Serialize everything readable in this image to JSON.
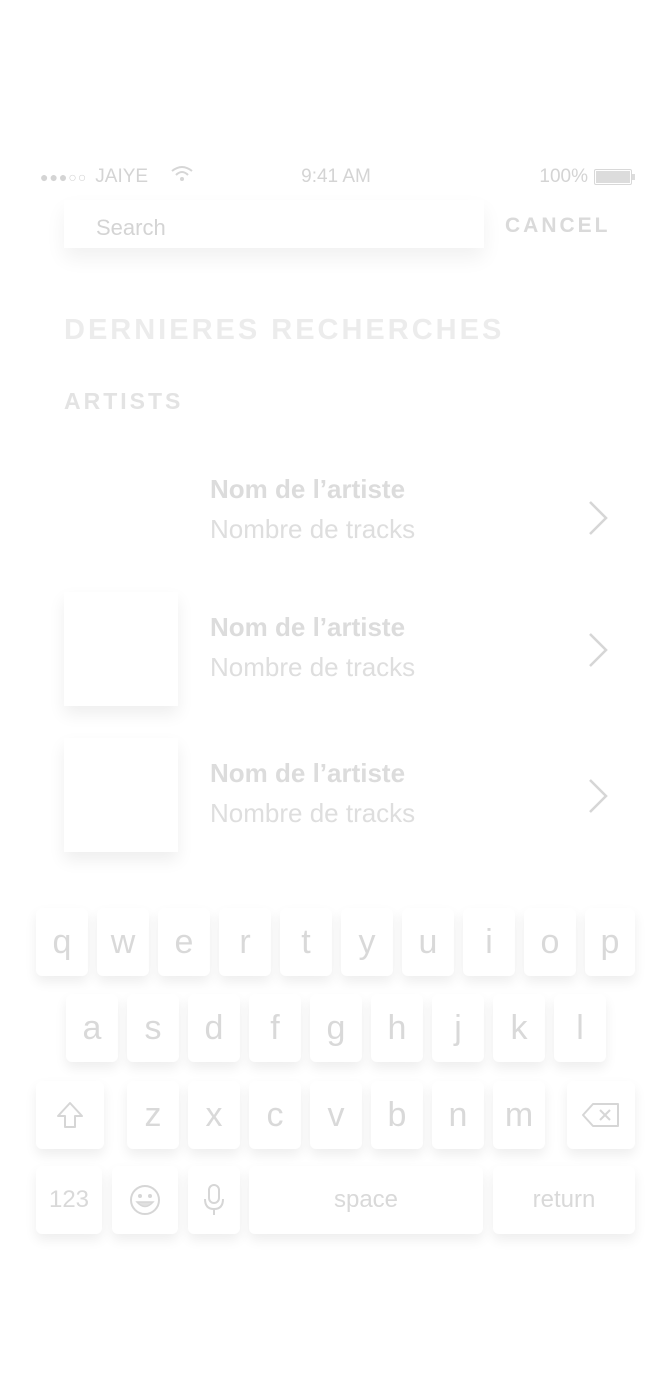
{
  "status_bar": {
    "signal_dots": "●●●○○",
    "carrier": "JAIYE",
    "time": "9:41 AM",
    "battery_percent": "100%"
  },
  "search": {
    "placeholder": "Search",
    "value": "",
    "cancel_label": "CANCEL"
  },
  "recent": {
    "section_title": "DERNIERES RECHERCHES",
    "artists_title": "ARTISTS",
    "items": [
      {
        "name": "Nom de l’artiste",
        "subtitle": "Nombre de tracks"
      },
      {
        "name": "Nom de l’artiste",
        "subtitle": "Nombre de tracks"
      },
      {
        "name": "Nom de l’artiste",
        "subtitle": "Nombre de tracks"
      }
    ]
  },
  "keyboard": {
    "row1": [
      "q",
      "w",
      "e",
      "r",
      "t",
      "y",
      "u",
      "i",
      "o",
      "p"
    ],
    "row2": [
      "a",
      "s",
      "d",
      "f",
      "g",
      "h",
      "j",
      "k",
      "l"
    ],
    "row3": [
      "z",
      "x",
      "c",
      "v",
      "b",
      "n",
      "m"
    ],
    "numbers_label": "123",
    "space_label": "space",
    "return_label": "return",
    "icons": {
      "shift": "shift-icon",
      "delete": "delete-icon",
      "emoji": "emoji-icon",
      "mic": "microphone-icon"
    }
  }
}
